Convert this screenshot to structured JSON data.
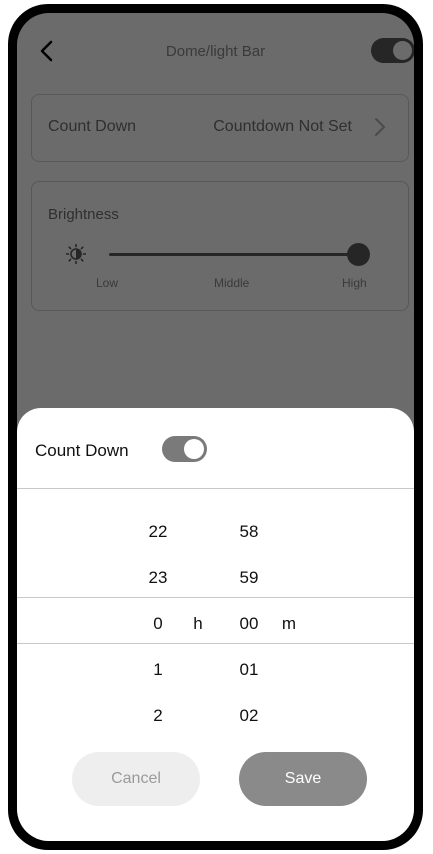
{
  "header": {
    "title": "Dome/light Bar",
    "power_on": true
  },
  "countdown_card": {
    "label": "Count Down",
    "value": "Countdown Not Set"
  },
  "brightness": {
    "label": "Brightness",
    "level": 1.0,
    "levels": [
      "Low",
      "Middle",
      "High"
    ]
  },
  "sheet": {
    "label": "Count Down",
    "toggle_on": true,
    "hours": {
      "above2": "22",
      "above1": "23",
      "selected": "0",
      "below1": "1",
      "below2": "2",
      "unit": "h"
    },
    "minutes": {
      "above2": "58",
      "above1": "59",
      "selected": "00",
      "below1": "01",
      "below2": "02",
      "unit": "m"
    },
    "cancel_label": "Cancel",
    "save_label": "Save"
  },
  "icons": [
    "back-chevron-icon",
    "power-toggle",
    "chevron-right-icon",
    "brightness-icon"
  ],
  "colors": {
    "overlay": "#6b6b6b",
    "dark": "#262626",
    "save_bg": "#8a8a8a",
    "cancel_bg": "#eeeeee"
  }
}
